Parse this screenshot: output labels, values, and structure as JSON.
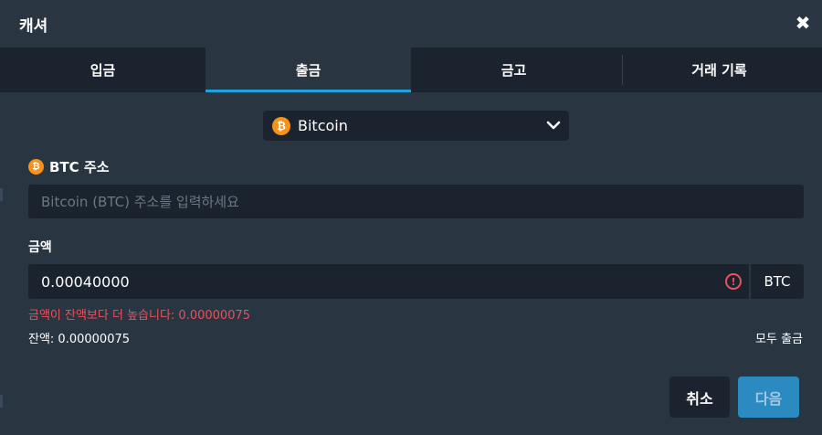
{
  "dialog": {
    "title": "캐셔"
  },
  "tabs": [
    {
      "label": "입금",
      "active": false
    },
    {
      "label": "출금",
      "active": true
    },
    {
      "label": "금고",
      "active": false
    },
    {
      "label": "거래 기록",
      "active": false
    }
  ],
  "coin_select": {
    "selected": "Bitcoin",
    "icon": "bitcoin-icon",
    "icon_glyph": "₿",
    "icon_color": "#f7931a"
  },
  "address": {
    "label": "BTC 주소",
    "placeholder": "Bitcoin (BTC) 주소를 입력하세요",
    "value": ""
  },
  "amount": {
    "label": "금액",
    "value": "0.00040000",
    "unit": "BTC",
    "warning_icon": "!"
  },
  "error_message": "금액이 잔액보다 더 높습니다: 0.00000075",
  "balance": "잔액: 0.00000075",
  "withdraw_all": "모두 출금",
  "buttons": {
    "cancel": "취소",
    "next": "다음"
  },
  "colors": {
    "accent": "#1fa3e0",
    "error": "#e5535d",
    "primary_button": "#2b8bc0",
    "background": "#2a3542",
    "panel": "#1b242e"
  }
}
